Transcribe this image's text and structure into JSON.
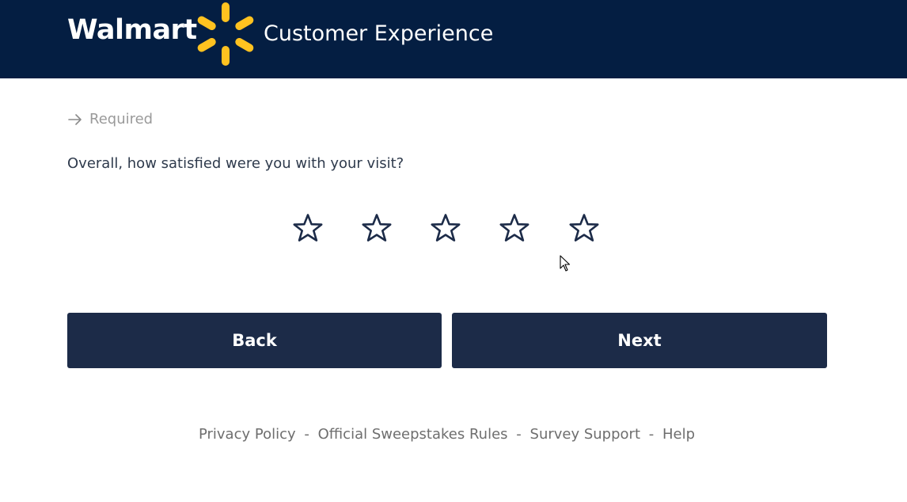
{
  "header": {
    "brand": "Walmart",
    "title": "Customer Experience",
    "colors": {
      "background": "#041e42",
      "spark": "#ffc220"
    },
    "logo_icon": "spark-icon"
  },
  "form": {
    "required_label": "Required",
    "required_icon": "arrow-right-icon",
    "question": "Overall, how satisfied were you with your visit?",
    "rating": {
      "max": 5,
      "selected": 0,
      "icon": "star-outline-icon"
    }
  },
  "buttons": {
    "back_label": "Back",
    "next_label": "Next",
    "color": "#1c2b48"
  },
  "footer": {
    "links": [
      "Privacy Policy",
      "Official Sweepstakes Rules",
      "Survey Support",
      "Help"
    ],
    "separator": "-"
  }
}
